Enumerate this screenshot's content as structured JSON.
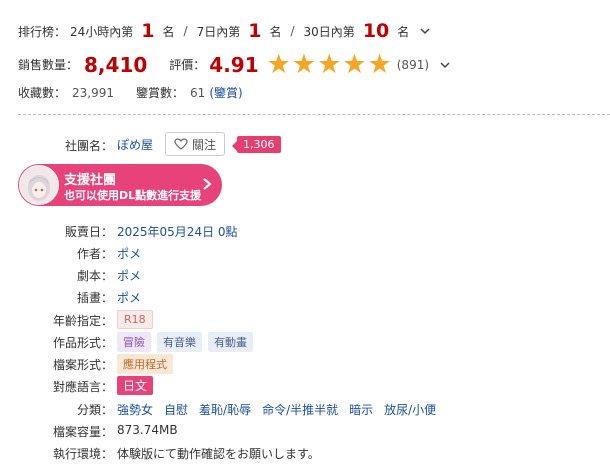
{
  "ranking": {
    "label": "排行榜：",
    "h24_label": "24小時內第",
    "h24_value": "1",
    "d7_label": "7日內第",
    "d7_value": "1",
    "d30_label": "30日內第",
    "d30_value": "10",
    "unit": "名",
    "sep": "/"
  },
  "sales": {
    "label": "銷售數量：",
    "value": "8,410",
    "rating_label": "評價：",
    "rating_value": "4.91",
    "stars": 5,
    "review_count": "(891)"
  },
  "stats": {
    "fav_label": "收藏數：",
    "fav_value": "23,991",
    "reviews_label": "鑒賞數：",
    "reviews_value": "61",
    "reviews_link": "(鑒賞)"
  },
  "circle": {
    "label": "社團名：",
    "name": "ぽめ屋",
    "follow_label": "關注",
    "follow_count": "1,306"
  },
  "support": {
    "title": "支援社團",
    "subtitle": "也可以使用DL點數進行支援"
  },
  "details": {
    "release_label": "販賣日：",
    "release_value": "2025年05月24日 0點",
    "author_label": "作者：",
    "author_value": "ポメ",
    "scenario_label": "劇本：",
    "scenario_value": "ポメ",
    "illust_label": "插畫：",
    "illust_value": "ポメ",
    "age_label": "年齡指定：",
    "age_value": "R18",
    "format_label": "作品形式：",
    "format_tags": [
      "冒險",
      "有音樂",
      "有動畫"
    ],
    "file_label": "檔案形式：",
    "file_value": "應用程式",
    "lang_label": "對應語言：",
    "lang_value": "日文",
    "genre_label": "分類：",
    "genres": [
      "強勢女",
      "自慰",
      "羞恥/恥辱",
      "命令/半推半就",
      "暗示",
      "放尿/小便"
    ],
    "size_label": "檔案容量：",
    "size_value": "873.74MB",
    "env_label": "執行環境：",
    "env_value": "体験版にて動作確認をお願いします。"
  },
  "colors": {
    "accent_red": "#c00000",
    "star": "#f5a623",
    "pink": "#e8427a",
    "link": "#1b4f9c"
  }
}
